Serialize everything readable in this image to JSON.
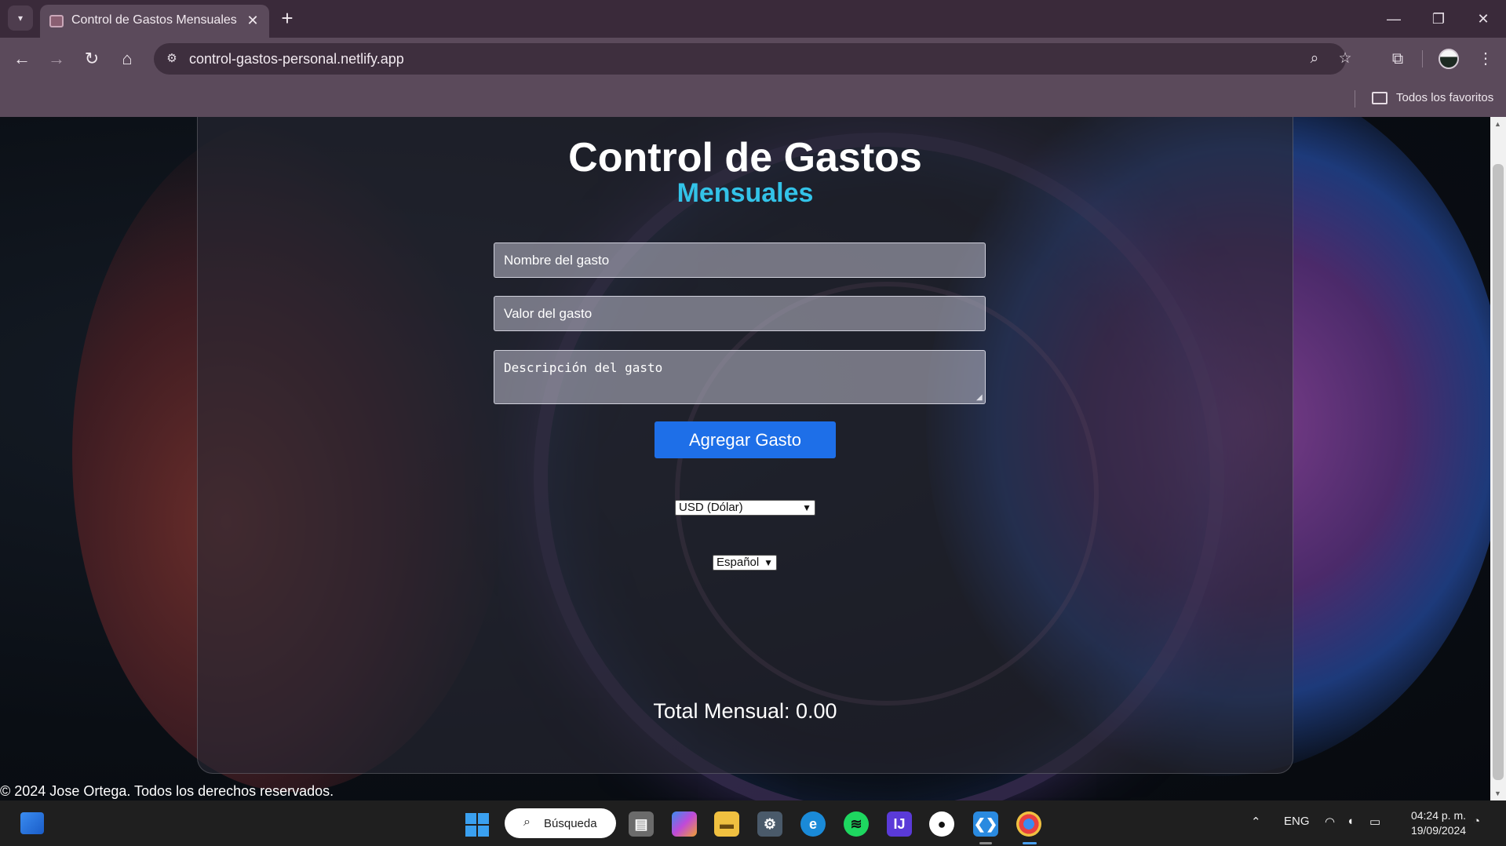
{
  "browser": {
    "tab_title": "Control de Gastos Mensuales",
    "url": "control-gastos-personal.netlify.app",
    "bookmarks_label": "Todos los favoritos"
  },
  "page": {
    "title": "Control de Gastos",
    "subtitle": "Mensuales",
    "name_placeholder": "Nombre del gasto",
    "value_placeholder": "Valor del gasto",
    "description_placeholder": "Descripción del gasto",
    "add_button_label": "Agregar Gasto",
    "currency_selected": "USD (Dólar)",
    "language_selected": "Español",
    "total_label": "Total Mensual: 0.00",
    "footer_text": "© 2024 Jose Ortega. Todos los derechos reservados."
  },
  "taskbar": {
    "search_label": "Búsqueda",
    "language": "ENG",
    "time": "04:24 p. m.",
    "date": "19/09/2024"
  }
}
